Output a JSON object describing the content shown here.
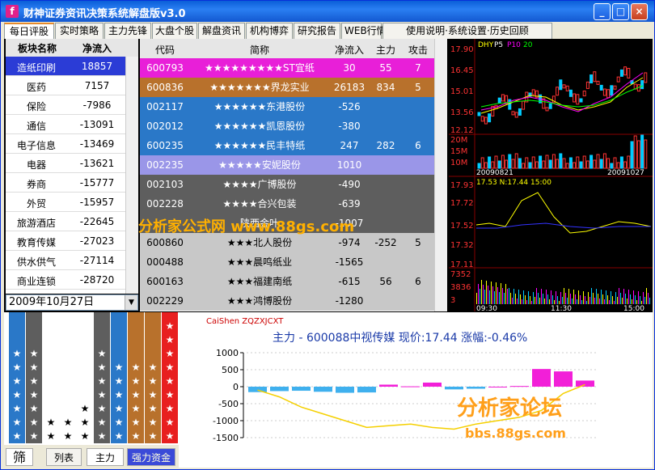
{
  "window": {
    "title": "财神证券资讯决策系统解盘版v3.0",
    "min": "_",
    "max": "□",
    "close": "×"
  },
  "tabs": [
    "每日评股",
    "实时策略",
    "主力先锋",
    "大盘个股",
    "解盘资讯",
    "机构博弈",
    "研究报告",
    "WEB行情",
    "使用说明·系统设置·历史回顾"
  ],
  "sector": {
    "headers": [
      "板块名称",
      "净流入"
    ],
    "rows": [
      {
        "name": "造纸印刷",
        "value": "18857"
      },
      {
        "name": "医药",
        "value": "7157"
      },
      {
        "name": "保险",
        "value": "-7986"
      },
      {
        "name": "通信",
        "value": "-13091"
      },
      {
        "name": "电子信息",
        "value": "-13469"
      },
      {
        "name": "电器",
        "value": "-13621"
      },
      {
        "name": "券商",
        "value": "-15777"
      },
      {
        "name": "外贸",
        "value": "-15957"
      },
      {
        "name": "旅游酒店",
        "value": "-22645"
      },
      {
        "name": "教育传媒",
        "value": "-27023"
      },
      {
        "name": "供水供气",
        "value": "-27114"
      },
      {
        "name": "商业连锁",
        "value": "-28720"
      }
    ],
    "date": "2009年10月27日"
  },
  "stocks": {
    "headers": [
      "代码",
      "简称",
      "净流入",
      "主力",
      "攻击"
    ],
    "rows": [
      {
        "code": "600793",
        "name": "★★★★★★★★★ST宜纸",
        "flow": "30",
        "main": "55",
        "attack": "7",
        "bg": "#e81fd8"
      },
      {
        "code": "600836",
        "name": "★★★★★★★界龙实业",
        "flow": "26183",
        "main": "834",
        "attack": "5",
        "bg": "#b8712c"
      },
      {
        "code": "002117",
        "name": "★★★★★★东港股份",
        "flow": "-526",
        "main": "",
        "attack": "",
        "bg": "#2a78c8"
      },
      {
        "code": "002012",
        "name": "★★★★★★凯恩股份",
        "flow": "-380",
        "main": "",
        "attack": "",
        "bg": "#2a78c8"
      },
      {
        "code": "600235",
        "name": "★★★★★★民丰特纸",
        "flow": "247",
        "main": "282",
        "attack": "6",
        "bg": "#2a78c8"
      },
      {
        "code": "002235",
        "name": "★★★★★安妮股份",
        "flow": "1010",
        "main": "",
        "attack": "",
        "bg": "#9a96e8"
      },
      {
        "code": "002103",
        "name": "★★★★广博股份",
        "flow": "-490",
        "main": "",
        "attack": "",
        "bg": "#5e5e5e"
      },
      {
        "code": "002228",
        "name": "★★★★合兴包装",
        "flow": "-639",
        "main": "",
        "attack": "",
        "bg": "#5e5e5e"
      },
      {
        "code": "",
        "name": "陕西金叶",
        "flow": "-1007",
        "main": "",
        "attack": "",
        "bg": "#5e5e5e"
      },
      {
        "code": "600860",
        "name": "★★★北人股份",
        "flow": "-974",
        "main": "-252",
        "attack": "5",
        "bg": "#c8c8c8"
      },
      {
        "code": "000488",
        "name": "★★★晨鸣纸业",
        "flow": "-1565",
        "main": "",
        "attack": "",
        "bg": "#c8c8c8"
      },
      {
        "code": "600163",
        "name": "★★★福建南纸",
        "flow": "-615",
        "main": "56",
        "attack": "6",
        "bg": "#c8c8c8"
      },
      {
        "code": "002229",
        "name": "★★★鸿博股份",
        "flow": "-1280",
        "main": "",
        "attack": "",
        "bg": "#c8c8c8"
      }
    ]
  },
  "kchart": {
    "legend": [
      "DHY",
      "P5",
      "P10",
      "20"
    ],
    "prices": [
      "17.90",
      "16.45",
      "15.01",
      "13.56",
      "12.12"
    ],
    "vol": [
      "20M",
      "15M",
      "10M"
    ],
    "dates": [
      "20090821",
      "20091027"
    ]
  },
  "tchart": {
    "header": "17.53 N:17.44 15:00",
    "prices": [
      "17.93",
      "17.72",
      "17.52",
      "17.32",
      "17.11"
    ],
    "vol": [
      "7352",
      "3836",
      "3"
    ],
    "times": [
      "09:30",
      "11:30",
      "15:00"
    ]
  },
  "bottom": {
    "source": "CaiShen ZQZXJCXT",
    "title": "主力 - 600088中视传媒   现价:17.44   涨幅:-0.46%",
    "yticks": [
      "1000",
      "500",
      "0",
      "-500",
      "-1000",
      "-1500"
    ],
    "bars": [
      -160,
      -130,
      -120,
      -150,
      -180,
      -170,
      60,
      10,
      120,
      -80,
      -60,
      0,
      20,
      520,
      450,
      180
    ],
    "line": [
      -100,
      -300,
      -600,
      -800,
      -1000,
      -1200,
      -1150,
      -1100,
      -1200,
      -1250,
      -1100,
      -1000,
      -900,
      -700,
      -200,
      60
    ],
    "buttons": {
      "filter": "筛",
      "list": "列表",
      "main": "主力",
      "rank": "强力资金"
    },
    "stars": {
      "cols": [
        {
          "count": 7,
          "bg": "#2a78c8",
          "color": "#fff"
        },
        {
          "count": 7,
          "bg": "#5e5e5e",
          "color": "#fff"
        },
        {
          "count": 2,
          "bg": "#fff",
          "color": "#000"
        },
        {
          "count": 2,
          "bg": "#fff",
          "color": "#000"
        },
        {
          "count": 3,
          "bg": "#fff",
          "color": "#000"
        },
        {
          "count": 7,
          "bg": "#5e5e5e",
          "color": "#fff"
        },
        {
          "count": 6,
          "bg": "#2a78c8",
          "color": "#fff"
        },
        {
          "count": 6,
          "bg": "#b8712c",
          "color": "#fff"
        },
        {
          "count": 6,
          "bg": "#b8712c",
          "color": "#fff"
        },
        {
          "count": 9,
          "bg": "#e81f1f",
          "color": "#fff"
        }
      ]
    }
  },
  "watermarks": {
    "top": "分析家公式网 www.88gs.com",
    "bottom1": "分析家论坛",
    "bottom2": "bbs.88gs.com"
  }
}
